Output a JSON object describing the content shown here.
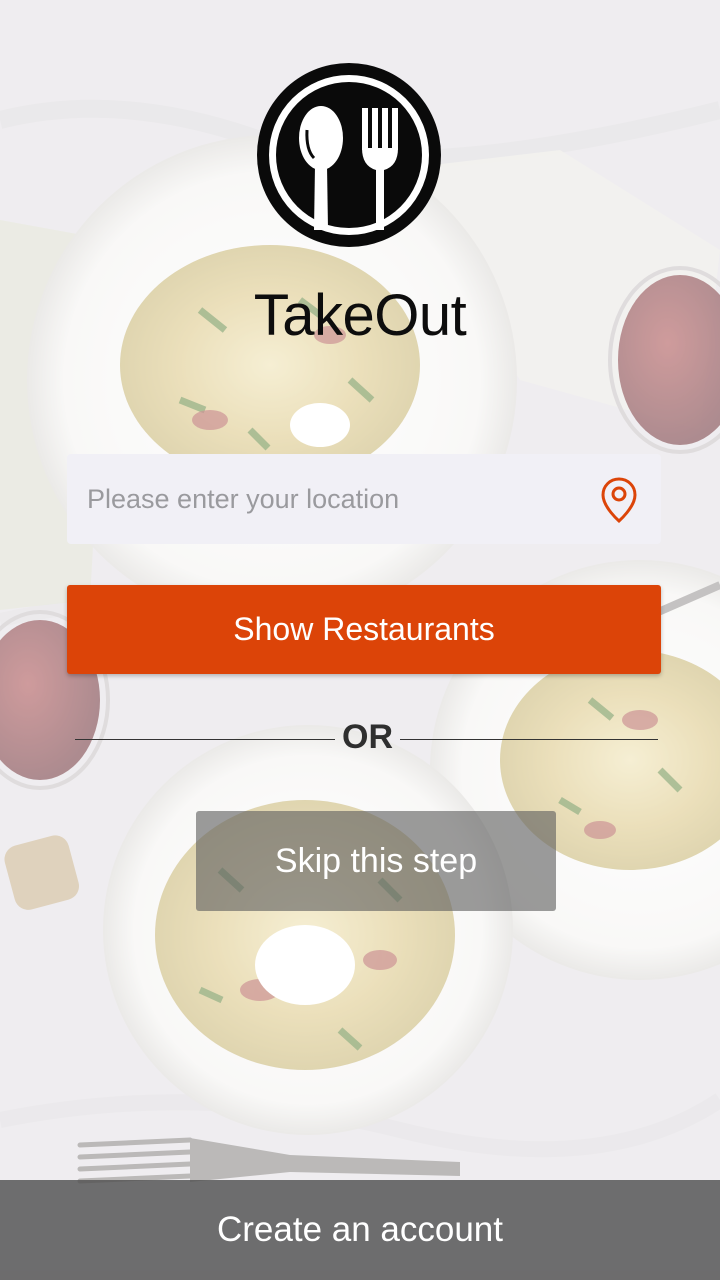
{
  "app": {
    "title": "TakeOut",
    "logo_icon": "spoon-fork-icon"
  },
  "location": {
    "placeholder": "Please enter your location",
    "value": "",
    "icon": "location-pin-icon"
  },
  "actions": {
    "show_restaurants_label": "Show Restaurants",
    "divider_text": "OR",
    "skip_label": "Skip this step",
    "create_account_label": "Create an account"
  },
  "colors": {
    "accent": "#dc4408",
    "field_bg": "#f1f0f6",
    "skip_bg": "#5f5f5f",
    "bottom_bar_bg": "#505050"
  },
  "background": {
    "description_icon": "pasta-plates-background"
  }
}
